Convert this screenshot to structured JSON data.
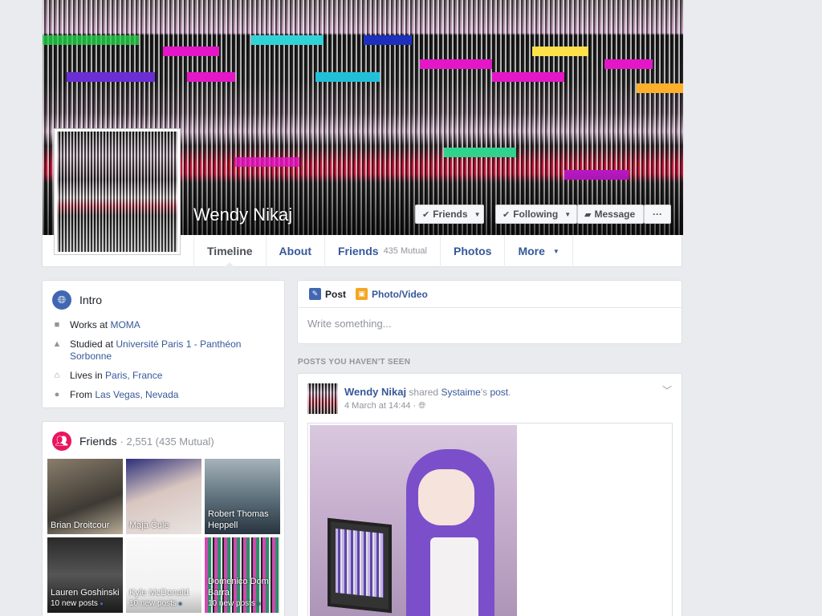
{
  "profile": {
    "name": "Wendy Nikaj",
    "buttons": {
      "friends": "Friends",
      "following": "Following",
      "message": "Message",
      "more_dots": "···"
    }
  },
  "tabs": [
    {
      "label": "Timeline",
      "active": true
    },
    {
      "label": "About"
    },
    {
      "label": "Friends",
      "sub": "435 Mutual"
    },
    {
      "label": "Photos"
    },
    {
      "label": "More"
    }
  ],
  "intro": {
    "title": "Intro",
    "rows": [
      {
        "prefix": "Works at ",
        "link": "MOMA",
        "icon": "briefcase-icon"
      },
      {
        "prefix": "Studied at ",
        "link": "Université Paris 1 - Panthéon Sorbonne",
        "icon": "graduation-cap-icon"
      },
      {
        "prefix": "Lives in ",
        "link": "Paris, France",
        "icon": "home-icon"
      },
      {
        "prefix": "From ",
        "link": "Las Vegas, Nevada",
        "icon": "location-pin-icon"
      }
    ]
  },
  "friends": {
    "title": "Friends",
    "count": "· 2,551 (435 Mutual)",
    "items": [
      {
        "name": "Brian Droitcour",
        "posts": ""
      },
      {
        "name": "Maja Čule",
        "posts": ""
      },
      {
        "name": "Robert Thomas Heppell",
        "posts": ""
      },
      {
        "name": "Lauren Goshinski",
        "posts": "10 new posts"
      },
      {
        "name": "Kyle McDonald",
        "posts": "10 new posts"
      },
      {
        "name": "Domenico Dom Barra",
        "posts": "10 new posts"
      }
    ]
  },
  "composer": {
    "post_tab": "Post",
    "photo_tab": "Photo/Video",
    "placeholder": "Write something..."
  },
  "posts_label": "POSTS YOU HAVEN'T SEEN",
  "post": {
    "author": "Wendy Nikaj",
    "shared": "shared",
    "source": "Systaime",
    "source_suffix": "'s",
    "object": "post",
    "date": "4 March at 14:44"
  },
  "colors": {
    "link": "#365899",
    "intro_icon": "#4267b2",
    "friends_icon": "#e9155e",
    "post_icon": "#4267b2",
    "photo_icon": "#f5a623"
  }
}
